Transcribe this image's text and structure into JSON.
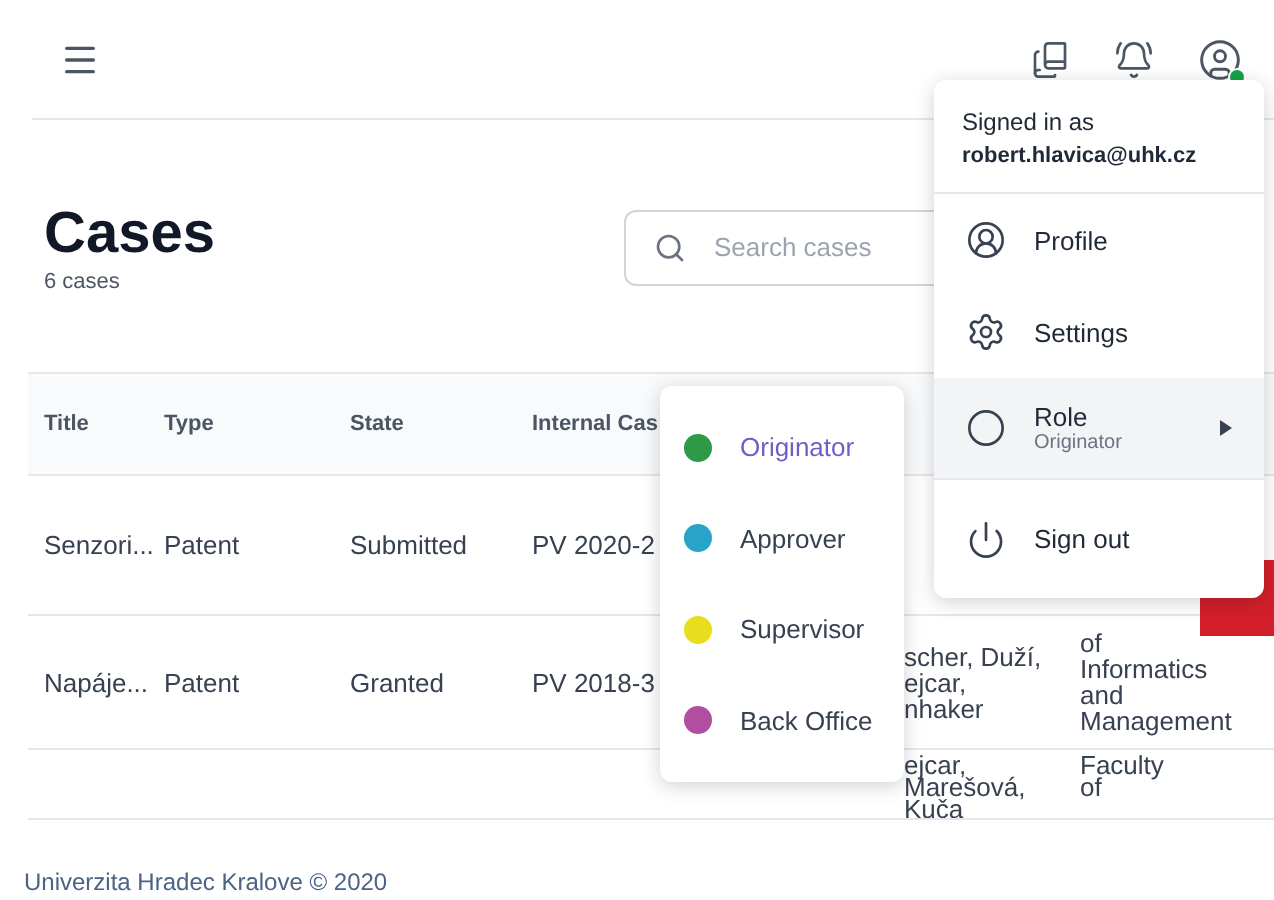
{
  "header": {
    "avatar": {
      "online": true
    }
  },
  "page": {
    "title": "Cases",
    "subtitle": "6 cases"
  },
  "search": {
    "placeholder": "Search cases"
  },
  "table": {
    "columns": [
      "Title",
      "Type",
      "State",
      "Internal Cas"
    ],
    "rows": [
      {
        "cells": [
          "Senzori...",
          "Patent",
          "Submitted",
          "PV 2020-2",
          null,
          null
        ]
      },
      {
        "cells": [
          "Napáje...",
          "Patent",
          "Granted",
          "PV 2018-3",
          "scher, Duží,\nejcar,\nnhaker",
          "of\nInformatics\nand\nManagement"
        ]
      },
      {
        "cells": [
          null,
          null,
          null,
          null,
          "ejcar,\nMarešová,\nKuča",
          "Faculty\nof"
        ]
      }
    ]
  },
  "user_menu": {
    "signed_in_label": "Signed in as",
    "email": "robert.hlavica@uhk.cz",
    "items": [
      {
        "kind": "link",
        "label": "Profile",
        "selected": false
      },
      {
        "kind": "link",
        "label": "Settings",
        "selected": false
      },
      {
        "kind": "submenu",
        "label": "Role",
        "value": "Originator",
        "expanded": true,
        "selected": true
      },
      {
        "kind": "link",
        "label": "Sign out",
        "selected": false
      }
    ]
  },
  "roles": [
    {
      "label": "Originator",
      "color": "#2e9a48",
      "selected": true
    },
    {
      "label": "Approver",
      "color": "#2aa3c9",
      "selected": false
    },
    {
      "label": "Supervisor",
      "color": "#e8de1e",
      "selected": false
    },
    {
      "label": "Back Office",
      "color": "#b04ea0",
      "selected": false
    }
  ],
  "footer": {
    "text": "Univerzita Hradec Kralove © 2020"
  }
}
